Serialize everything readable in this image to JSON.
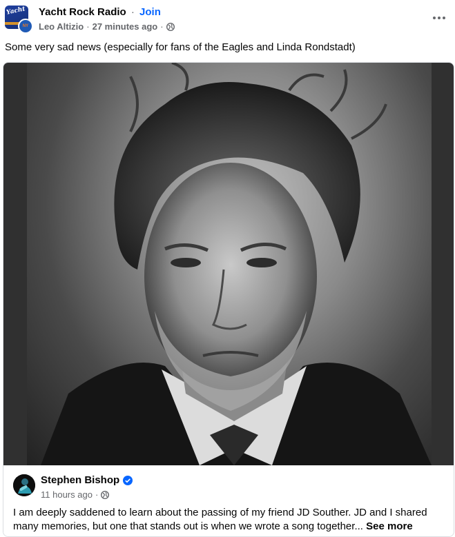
{
  "header": {
    "group_name": "Yacht Rock Radio",
    "separator": "·",
    "join_label": "Join",
    "author": "Leo Altizio",
    "meta_separator": "·",
    "timestamp": "27 minutes ago",
    "audience_icon": "globe-icon",
    "menu_icon": "more-options-icon"
  },
  "post": {
    "text": "Some very sad news (especially for fans of the Eagles and Linda Rondstadt)"
  },
  "shared_card": {
    "photo_alt": "Black and white portrait",
    "author": "Stephen Bishop",
    "verified_icon": "verified-badge-icon",
    "timestamp": "11 hours ago",
    "meta_separator": "·",
    "body_line1": "I am deeply saddened to learn about the passing of my friend JD Souther. JD and I shared",
    "body_line2": "many memories, but one that stands out is when we wrote a song together...",
    "see_more_label": "See more"
  },
  "colors": {
    "link_blue": "#0866ff",
    "secondary_text": "#65676b",
    "primary_text": "#050505",
    "border": "#dadde1"
  }
}
